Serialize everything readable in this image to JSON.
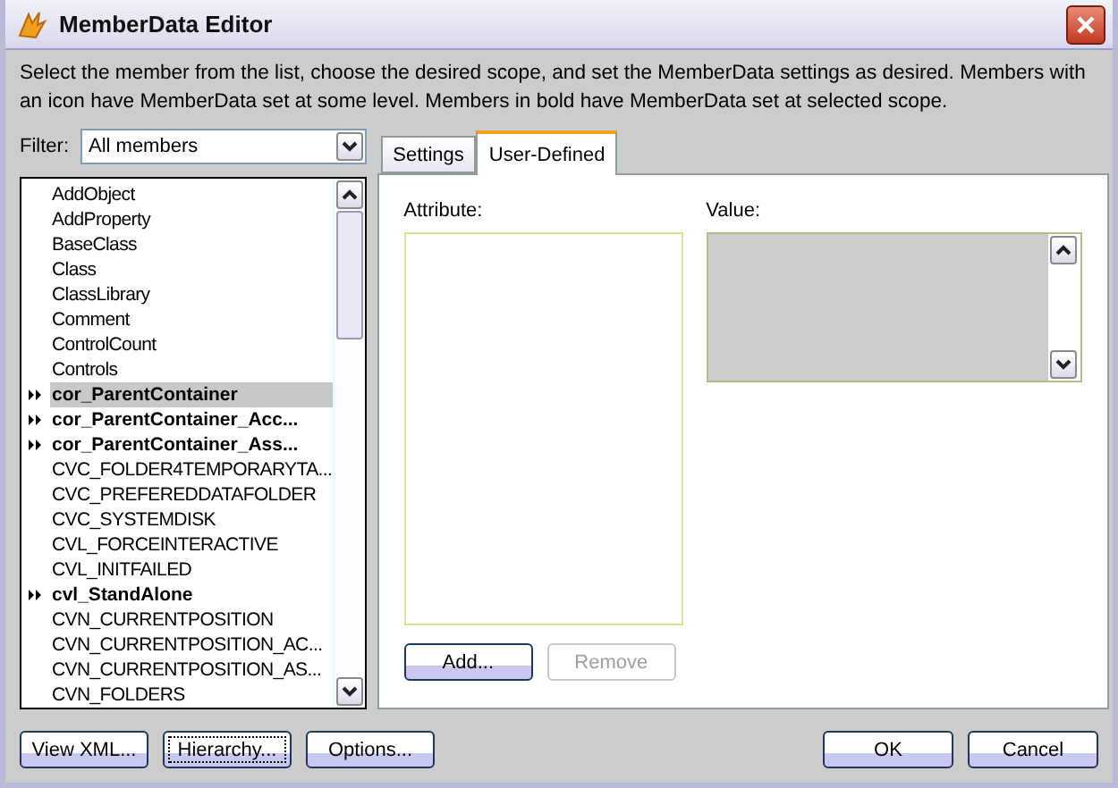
{
  "window": {
    "title": "MemberData Editor"
  },
  "description": "Select the member from the list, choose the desired scope, and set the MemberData settings as desired. Members with an icon have MemberData set at some level. Members in bold have MemberData set at selected scope.",
  "filter": {
    "label": "Filter:",
    "value": "All members"
  },
  "members": [
    {
      "name": "AddObject",
      "marked": false,
      "bold": false,
      "selected": false
    },
    {
      "name": "AddProperty",
      "marked": false,
      "bold": false,
      "selected": false
    },
    {
      "name": "BaseClass",
      "marked": false,
      "bold": false,
      "selected": false
    },
    {
      "name": "Class",
      "marked": false,
      "bold": false,
      "selected": false
    },
    {
      "name": "ClassLibrary",
      "marked": false,
      "bold": false,
      "selected": false
    },
    {
      "name": "Comment",
      "marked": false,
      "bold": false,
      "selected": false
    },
    {
      "name": "ControlCount",
      "marked": false,
      "bold": false,
      "selected": false
    },
    {
      "name": "Controls",
      "marked": false,
      "bold": false,
      "selected": false
    },
    {
      "name": "cor_ParentContainer",
      "marked": true,
      "bold": true,
      "selected": true
    },
    {
      "name": "cor_ParentContainer_Acc...",
      "marked": true,
      "bold": true,
      "selected": false
    },
    {
      "name": "cor_ParentContainer_Ass...",
      "marked": true,
      "bold": true,
      "selected": false
    },
    {
      "name": "CVC_FOLDER4TEMPORARYTA...",
      "marked": false,
      "bold": false,
      "selected": false
    },
    {
      "name": "CVC_PREFEREDDATAFOLDER",
      "marked": false,
      "bold": false,
      "selected": false
    },
    {
      "name": "CVC_SYSTEMDISK",
      "marked": false,
      "bold": false,
      "selected": false
    },
    {
      "name": "CVL_FORCEINTERACTIVE",
      "marked": false,
      "bold": false,
      "selected": false
    },
    {
      "name": "CVL_INITFAILED",
      "marked": false,
      "bold": false,
      "selected": false
    },
    {
      "name": "cvl_StandAlone",
      "marked": true,
      "bold": true,
      "selected": false
    },
    {
      "name": "CVN_CURRENTPOSITION",
      "marked": false,
      "bold": false,
      "selected": false
    },
    {
      "name": "CVN_CURRENTPOSITION_AC...",
      "marked": false,
      "bold": false,
      "selected": false
    },
    {
      "name": "CVN_CURRENTPOSITION_AS...",
      "marked": false,
      "bold": false,
      "selected": false
    },
    {
      "name": "CVN_FOLDERS",
      "marked": false,
      "bold": false,
      "selected": false
    }
  ],
  "tabs": [
    {
      "label": "Settings",
      "selected": false
    },
    {
      "label": "User-Defined",
      "selected": true
    }
  ],
  "attribute": {
    "label": "Attribute:"
  },
  "value": {
    "label": "Value:",
    "disabled": true
  },
  "panel_buttons": [
    {
      "label": "Add...",
      "disabled": false,
      "focused": false
    },
    {
      "label": "Remove",
      "disabled": true,
      "focused": false
    }
  ],
  "footer_left": [
    {
      "label": "View XML...",
      "focused": false
    },
    {
      "label": "Hierarchy...",
      "focused": true
    },
    {
      "label": "Options...",
      "focused": false
    }
  ],
  "footer_right": [
    {
      "label": "OK",
      "focused": false
    },
    {
      "label": "Cancel",
      "focused": false
    }
  ]
}
